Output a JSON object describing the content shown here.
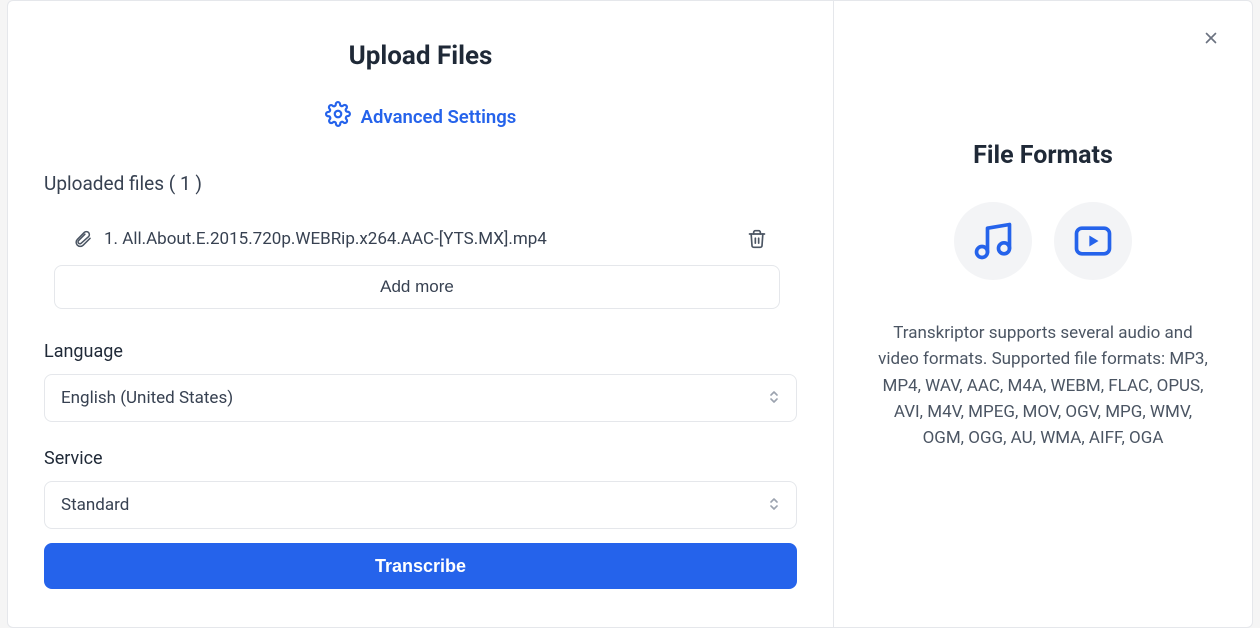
{
  "header": {
    "title": "Upload Files",
    "advanced_label": "Advanced Settings"
  },
  "uploaded": {
    "heading": "Uploaded files ( 1 )",
    "files": [
      {
        "name": "1. All.About.E.2015.720p.WEBRip.x264.AAC-[YTS.MX].mp4"
      }
    ],
    "add_more_label": "Add more"
  },
  "language": {
    "label": "Language",
    "value": "English (United States)"
  },
  "service": {
    "label": "Service",
    "value": "Standard"
  },
  "actions": {
    "transcribe_label": "Transcribe"
  },
  "side": {
    "title": "File Formats",
    "description": "Transkriptor supports several audio and video formats. Supported file formats: MP3, MP4, WAV, AAC, M4A, WEBM, FLAC, OPUS, AVI, M4V, MPEG, MOV, OGV, MPG, WMV, OGM, OGG, AU, WMA, AIFF, OGA"
  }
}
